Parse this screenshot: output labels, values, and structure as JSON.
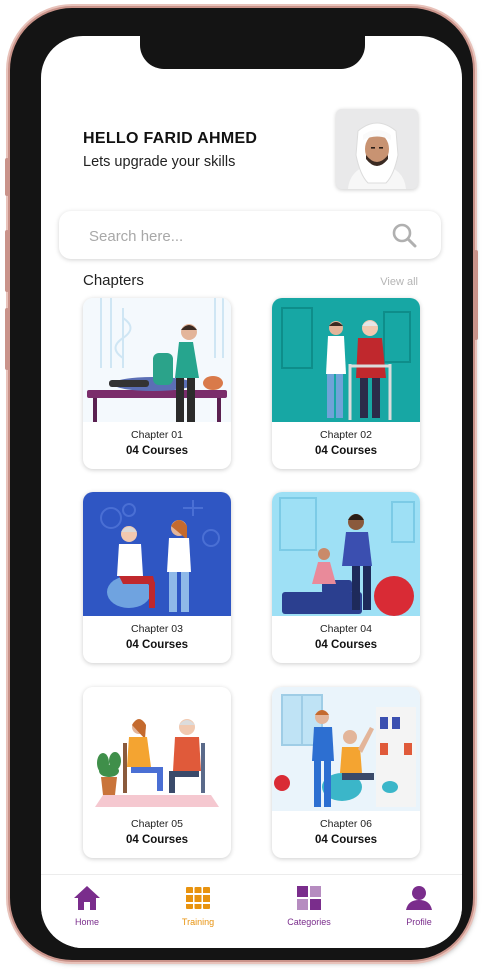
{
  "header": {
    "title": "HELLO FARID AHMED",
    "subtitle": "Lets upgrade your skills"
  },
  "search": {
    "placeholder": "Search here..."
  },
  "chapters": {
    "title": "Chapters",
    "view_all": "View all",
    "items": [
      {
        "chapter": "Chapter 01",
        "courses": "04 Courses"
      },
      {
        "chapter": "Chapter 02",
        "courses": "04 Courses"
      },
      {
        "chapter": "Chapter 03",
        "courses": "04 Courses"
      },
      {
        "chapter": "Chapter 04",
        "courses": "04 Courses"
      },
      {
        "chapter": "Chapter 05",
        "courses": "04 Courses"
      },
      {
        "chapter": "Chapter 06",
        "courses": "04 Courses"
      }
    ]
  },
  "nav": {
    "items": [
      {
        "label": "Home",
        "icon": "home-icon",
        "color": "#7a2d8c"
      },
      {
        "label": "Training",
        "icon": "books-icon",
        "color": "#e8930f"
      },
      {
        "label": "Categories",
        "icon": "categories-icon",
        "color": "#7a2d8c"
      },
      {
        "label": "Profile",
        "icon": "profile-icon",
        "color": "#7a2d8c"
      }
    ]
  },
  "colors": {
    "brand": "#7a2d8c",
    "accent": "#e8930f"
  }
}
